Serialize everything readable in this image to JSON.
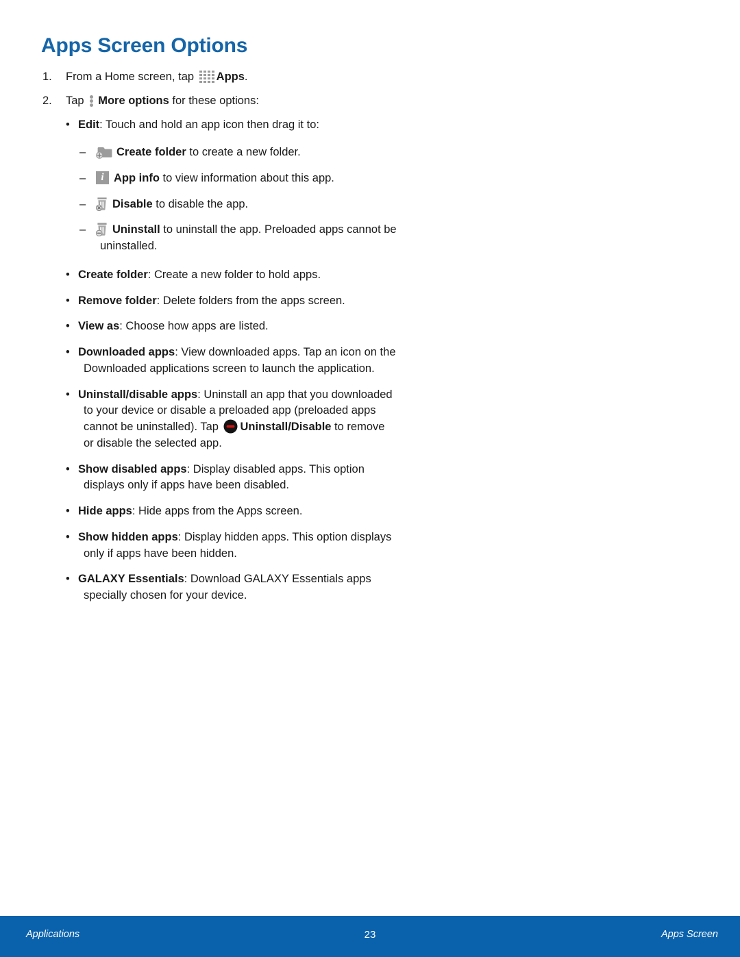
{
  "page": {
    "title": "Apps Screen Options",
    "title_color": "#1565A8"
  },
  "steps": [
    {
      "number": "1.",
      "text_before": "From a Home screen, tap",
      "icon": "apps-grid-icon",
      "bold_label": "Apps",
      "text_after": "."
    },
    {
      "number": "2.",
      "text_before": "Tap",
      "icon": "more-options-icon",
      "bold_label": "More options",
      "text_after": " for these options:"
    }
  ],
  "options": [
    {
      "label": "Edit",
      "separator": ":",
      "text": " Touch and hold an app icon then drag it to:"
    },
    {
      "label": "Create folder",
      "separator": ":",
      "text": " Create a new folder to hold apps."
    },
    {
      "label": "Remove folder",
      "separator": ":",
      "text": " Delete folders from the apps screen."
    },
    {
      "label": "View as",
      "separator": ":",
      "text": " Choose how apps are listed."
    },
    {
      "label": "Downloaded apps",
      "separator": ":",
      "text": " View downloaded apps. Tap an icon on the Downloaded applications screen to launch the application."
    },
    {
      "label": "Uninstall/disable apps",
      "separator": ":",
      "text_part1": " Uninstall an app that you downloaded to your device or disable a preloaded app (preloaded apps cannot be uninstalled). Tap ",
      "icon": "uninstall-disable-icon",
      "label2": "Uninstall/Disable",
      "text_part2": " to remove or disable the selected app."
    },
    {
      "label": "Show disabled apps",
      "separator": ":",
      "text": " Display disabled apps. This option displays only if apps have been disabled."
    },
    {
      "label": "Hide apps",
      "separator": ":",
      "text": " Hide apps from the Apps screen."
    },
    {
      "label": "Show hidden apps",
      "separator": ":",
      "text": " Display hidden apps. This option displays only if apps have been hidden."
    },
    {
      "label": "GALAXY Essentials",
      "separator": ":",
      "text": " Download GALAXY Essentials apps specially chosen for your device."
    }
  ],
  "edit_subitems": [
    {
      "icon": "create-folder-icon",
      "label": "Create folder",
      "text": " to create a new folder."
    },
    {
      "icon": "app-info-icon",
      "label": "App info",
      "text": " to view information about this app."
    },
    {
      "icon": "disable-trash-icon",
      "label": "Disable",
      "text": " to disable the app."
    },
    {
      "icon": "uninstall-trash-icon",
      "label": "Uninstall",
      "text": " to uninstall the app. Preloaded apps cannot be uninstalled."
    }
  ],
  "footer": {
    "left": "Applications",
    "page_number": "23",
    "right": "Apps Screen",
    "background": "#0B62AC"
  }
}
